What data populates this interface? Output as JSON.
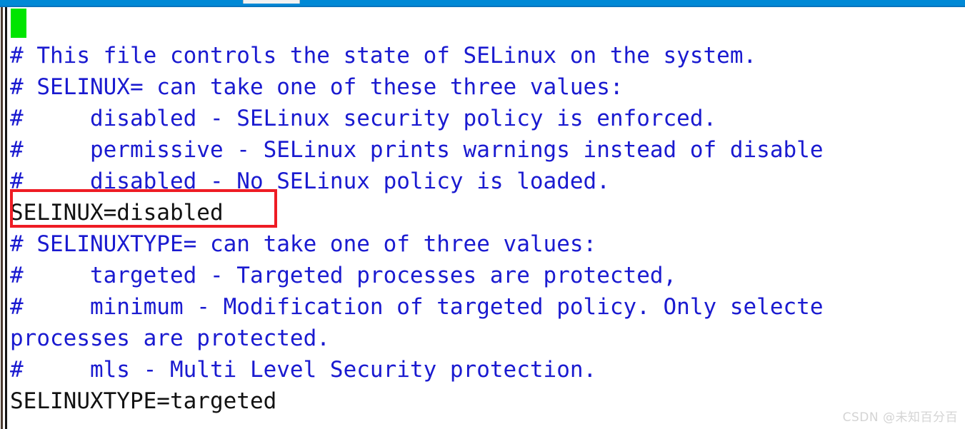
{
  "window": {
    "title_bar_color": "#0089d6",
    "background_color": "#ffffff"
  },
  "editor": {
    "cursor": {
      "color": "#00e500",
      "label": "block-cursor"
    },
    "comment_color": "#1a1ad0",
    "text_color": "#121212",
    "lines": [
      {
        "id": "l1",
        "text": "# This file controls the state of SELinux on the system.",
        "style": "comment"
      },
      {
        "id": "l2",
        "text": "# SELINUX= can take one of these three values:",
        "style": "comment"
      },
      {
        "id": "l3",
        "text": "#     disabled - SELinux security policy is enforced.",
        "style": "comment"
      },
      {
        "id": "l4",
        "text": "#     permissive - SELinux prints warnings instead of disable",
        "style": "comment"
      },
      {
        "id": "l5",
        "text": "#     disabled - No SELinux policy is loaded.",
        "style": "comment"
      },
      {
        "id": "l6",
        "text": "SELINUX=disabled",
        "style": "plain"
      },
      {
        "id": "l7",
        "text": "# SELINUXTYPE= can take one of three values:",
        "style": "comment"
      },
      {
        "id": "l8",
        "text": "#     targeted - Targeted processes are protected,",
        "style": "comment"
      },
      {
        "id": "l9",
        "text": "#     minimum - Modification of targeted policy. Only selecte",
        "style": "comment"
      },
      {
        "id": "l10",
        "text": "processes are protected.",
        "style": "comment"
      },
      {
        "id": "l11",
        "text": "#     mls - Multi Level Security protection.",
        "style": "comment"
      },
      {
        "id": "l12",
        "text": "SELINUXTYPE=targeted",
        "style": "plain"
      }
    ]
  },
  "annotation": {
    "color": "#ee1c24",
    "target_text": "SELINUX=disabled",
    "shape": "rectangle"
  },
  "watermark": {
    "text": "CSDN @未知百分百",
    "color": "#d4d4d4"
  }
}
